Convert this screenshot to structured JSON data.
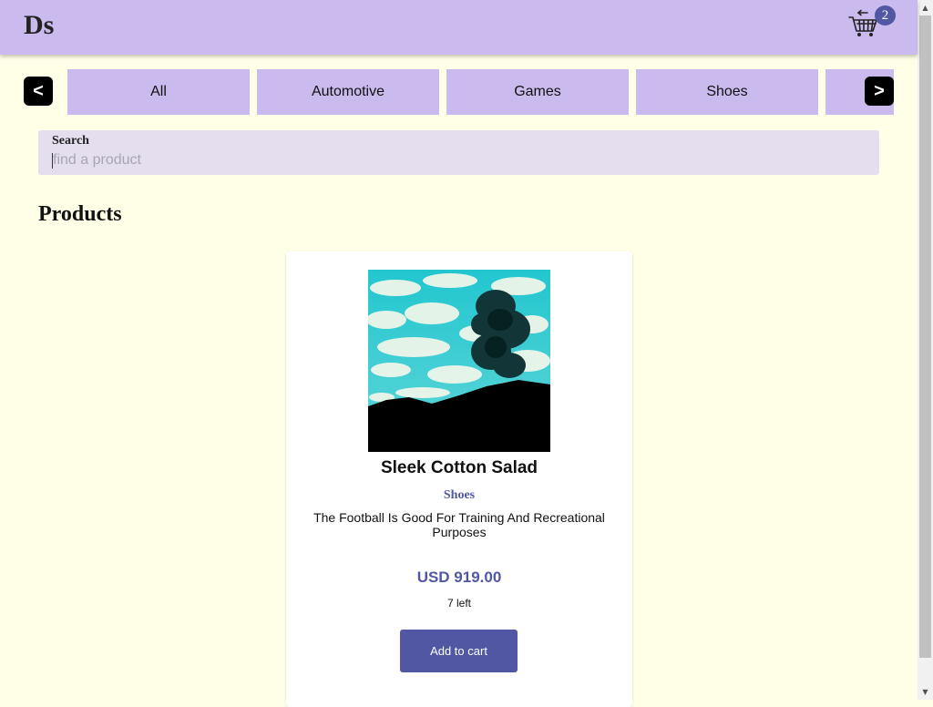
{
  "header": {
    "logo": "Ds",
    "cart": {
      "icon": "shopping-cart-icon",
      "count": "2"
    }
  },
  "categories": {
    "prev_label": "<",
    "next_label": ">",
    "items": [
      {
        "label": "All"
      },
      {
        "label": "Automotive"
      },
      {
        "label": "Games"
      },
      {
        "label": "Shoes"
      },
      {
        "label": ""
      }
    ]
  },
  "search": {
    "label": "Search",
    "placeholder": "find a product",
    "value": ""
  },
  "products": {
    "heading": "Products",
    "items": [
      {
        "name": "Sleek Cotton Salad",
        "category": "Shoes",
        "description": "The Football Is Good For Training And Recreational Purposes",
        "price": "USD 919.00",
        "stock": "7 left",
        "button": "Add to cart"
      }
    ]
  },
  "colors": {
    "header_bg": "#cbbaee",
    "page_bg": "#ffffe8",
    "accent": "#5157a3",
    "search_bg": "#e4deef"
  }
}
